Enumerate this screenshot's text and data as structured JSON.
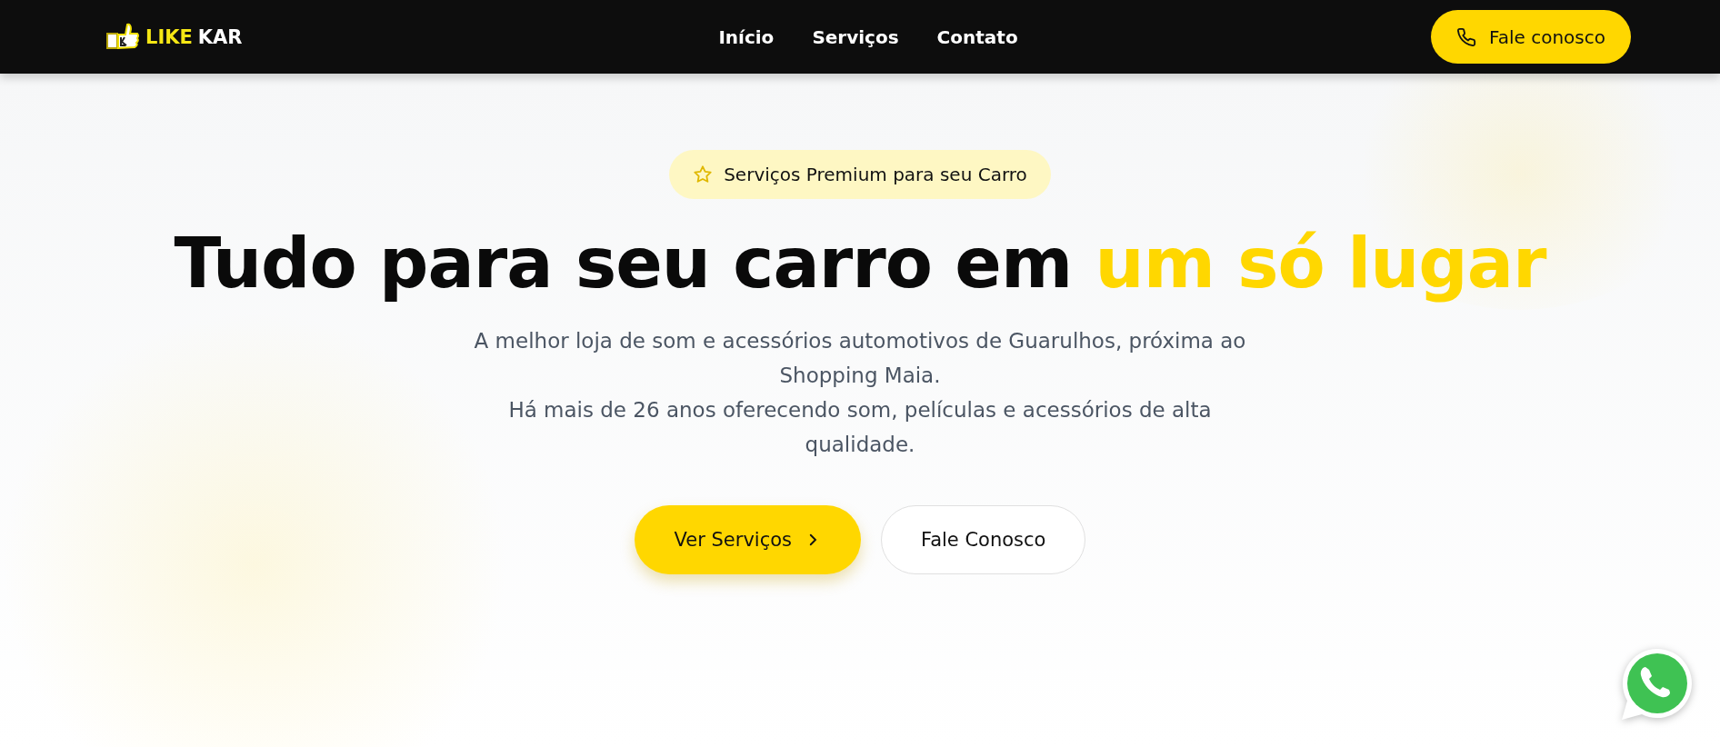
{
  "header": {
    "logo": {
      "words": [
        {
          "text": "LIKE",
          "highlight": true
        },
        {
          "text": "KAR",
          "highlight": false
        }
      ]
    },
    "nav": [
      "Início",
      "Serviços",
      "Contato"
    ],
    "cta": "Fale conosco"
  },
  "hero": {
    "badge": "Serviços Premium para seu Carro",
    "headline": [
      {
        "text": "Tudo para seu carro em",
        "highlight": false
      },
      {
        "text": "um só lugar",
        "highlight": true
      }
    ],
    "description": [
      "A melhor loja de som e acessórios automotivos de Guarulhos, próxima ao Shopping Maia.",
      "Há mais de 26 anos oferecendo som, películas e acessórios de alta qualidade."
    ],
    "buttons": [
      {
        "label": "Ver Serviços",
        "kind": "primary"
      },
      {
        "label": "Fale Conosco",
        "kind": "secondary"
      }
    ]
  }
}
